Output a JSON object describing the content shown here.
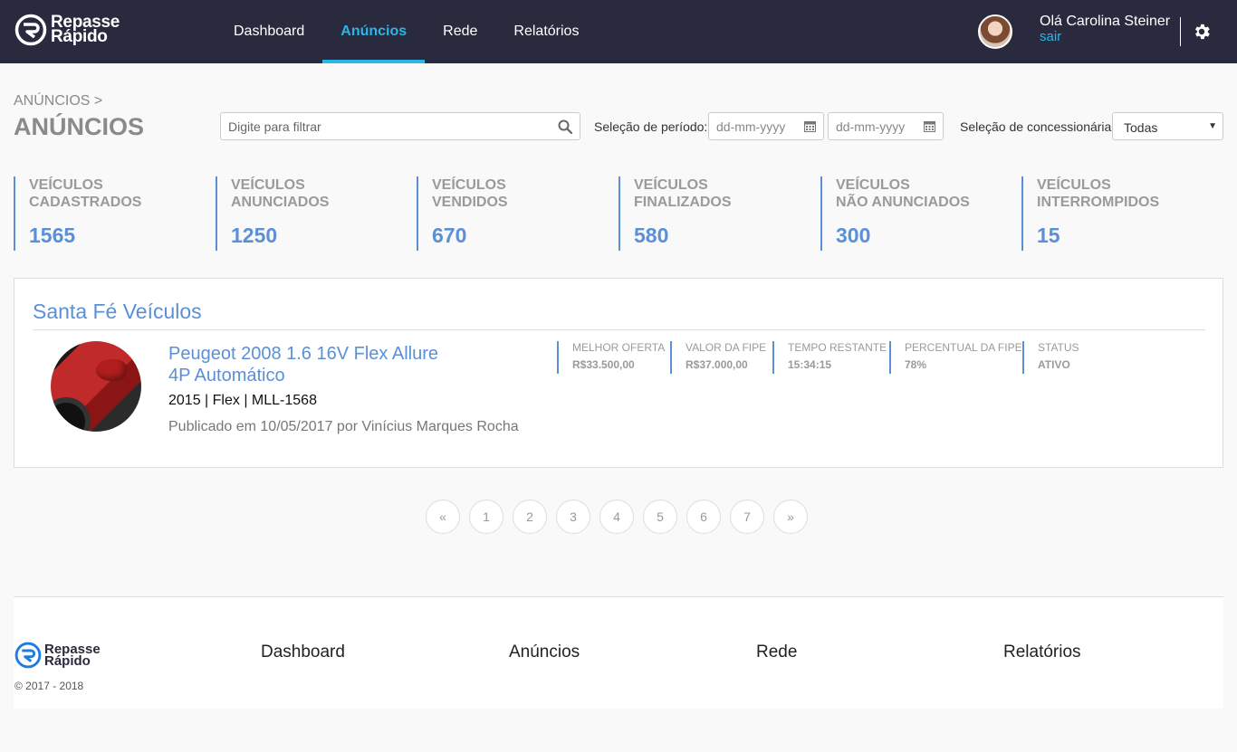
{
  "header": {
    "logo_line1": "Repasse",
    "logo_line2": "Rápido",
    "nav": [
      {
        "label": "Dashboard",
        "active": false
      },
      {
        "label": "Anúncios",
        "active": true
      },
      {
        "label": "Rede",
        "active": false
      },
      {
        "label": "Relatórios",
        "active": false
      }
    ],
    "user_greeting": "Olá Carolina Steiner",
    "logout_label": "sair"
  },
  "page": {
    "breadcrumb": "ANÚNCIOS >",
    "title": "ANÚNCIOS"
  },
  "filters": {
    "search_placeholder": "Digite para filtrar",
    "period_label": "Seleção de período:",
    "date_start_placeholder": "dd-mm-yyyy",
    "date_end_placeholder": "dd-mm-yyyy",
    "dealer_label": "Seleção de concessionária:",
    "dealer_selected": "Todas"
  },
  "stats": [
    {
      "line1": "Veículos",
      "line2": "Cadastrados",
      "value": "1565"
    },
    {
      "line1": "Veículos",
      "line2": "Anunciados",
      "value": "1250"
    },
    {
      "line1": "Veículos",
      "line2": "Vendidos",
      "value": "670"
    },
    {
      "line1": "Veículos",
      "line2": "Finalizados",
      "value": "580"
    },
    {
      "line1": "Veículos",
      "line2": "Não Anunciados",
      "value": "300"
    },
    {
      "line1": "Veículos",
      "line2": "Interrompidos",
      "value": "15"
    }
  ],
  "listing": {
    "dealer_name": "Santa Fé Veículos",
    "car_title": "Peugeot 2008 1.6 16V Flex Allure 4P Automático",
    "car_specs": "2015 | Flex | MLL-1568",
    "published": "Publicado em 10/05/2017 por Vinícius Marques Rocha",
    "metrics": [
      {
        "label": "Melhor oferta",
        "value": "R$33.500,00"
      },
      {
        "label": "Valor da FIPE",
        "value": "R$37.000,00"
      },
      {
        "label": "Tempo restante",
        "value": "15:34:15"
      },
      {
        "label": "Percentual da FIPE",
        "value": "78%"
      },
      {
        "label": "Status",
        "value": "ATIVO"
      }
    ]
  },
  "pagination": {
    "prev": "«",
    "pages": [
      "1",
      "2",
      "3",
      "4",
      "5",
      "6",
      "7"
    ],
    "next": "»"
  },
  "footer": {
    "logo_line1": "Repasse",
    "logo_line2": "Rápido",
    "copyright": "© 2017 - 2018",
    "links": [
      "Dashboard",
      "Anúncios",
      "Rede",
      "Relatórios"
    ]
  },
  "colors": {
    "header_bg": "#2a2a3e",
    "accent_cyan": "#2bb6e6",
    "accent_blue": "#5b8fd6"
  },
  "icons": [
    "logo-icon",
    "avatar",
    "gear-icon",
    "search-icon",
    "calendar-icon",
    "chevron-down-icon",
    "car-photo"
  ]
}
